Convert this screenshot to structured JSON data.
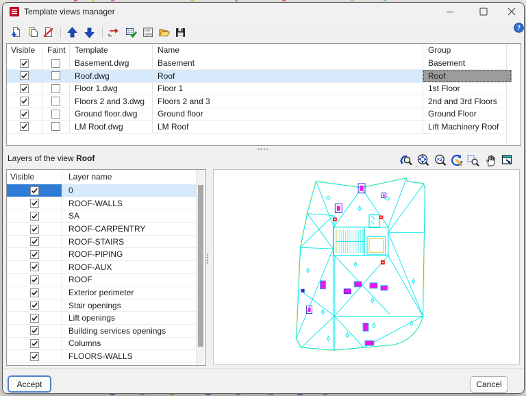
{
  "window": {
    "title": "Template views manager"
  },
  "toolbar": {
    "icons": [
      "new-template",
      "copy-template",
      "delete-template",
      "move-up",
      "move-down",
      "assign-template",
      "update-views",
      "dwg-options",
      "open-file",
      "save-file"
    ]
  },
  "help": {
    "tooltip": "help"
  },
  "templates_table": {
    "headers": {
      "visible": "Visible",
      "faint": "Faint",
      "template": "Template",
      "name": "Name",
      "group": "Group"
    },
    "rows": [
      {
        "visible": true,
        "faint": false,
        "template": "Basement.dwg",
        "name": "Basement",
        "group": "Basement",
        "selected": false
      },
      {
        "visible": true,
        "faint": false,
        "template": "Roof.dwg",
        "name": "Roof",
        "group": "Roof",
        "selected": true
      },
      {
        "visible": true,
        "faint": false,
        "template": "Floor 1.dwg",
        "name": "Floor 1",
        "group": "1st Floor",
        "selected": false
      },
      {
        "visible": true,
        "faint": false,
        "template": "Floors 2 and 3.dwg",
        "name": "Floors 2 and 3",
        "group": "2nd and 3rd Floors",
        "selected": false
      },
      {
        "visible": true,
        "faint": false,
        "template": "Ground floor.dwg",
        "name": "Ground floor",
        "group": "Ground Floor",
        "selected": false
      },
      {
        "visible": true,
        "faint": false,
        "template": "LM Roof.dwg",
        "name": "LM Roof",
        "group": "Lift Machinery Roof",
        "selected": false
      }
    ]
  },
  "layers_panel": {
    "label": "Layers of the view",
    "view_name": "Roof"
  },
  "preview_toolbar": {
    "icons": [
      "zoom-previous",
      "zoom-extents",
      "zoom-scale",
      "regen-view",
      "zoom-window",
      "pan",
      "fit-window"
    ]
  },
  "layers_table": {
    "headers": {
      "visible": "Visible",
      "layer": "Layer name"
    },
    "rows": [
      {
        "visible": true,
        "layer": "0",
        "selected": true
      },
      {
        "visible": true,
        "layer": "ROOF-WALLS",
        "selected": false
      },
      {
        "visible": true,
        "layer": "SA",
        "selected": false
      },
      {
        "visible": true,
        "layer": "ROOF-CARPENTRY",
        "selected": false
      },
      {
        "visible": true,
        "layer": "ROOF-STAIRS",
        "selected": false
      },
      {
        "visible": true,
        "layer": "ROOF-PIPING",
        "selected": false
      },
      {
        "visible": true,
        "layer": "ROOF-AUX",
        "selected": false
      },
      {
        "visible": true,
        "layer": "ROOF",
        "selected": false
      },
      {
        "visible": true,
        "layer": "Exterior perimeter",
        "selected": false
      },
      {
        "visible": true,
        "layer": "Stair openings",
        "selected": false
      },
      {
        "visible": true,
        "layer": "Lift openings",
        "selected": false
      },
      {
        "visible": true,
        "layer": "Building services openings",
        "selected": false
      },
      {
        "visible": true,
        "layer": "Columns",
        "selected": false
      },
      {
        "visible": true,
        "layer": "FLOORS-WALLS",
        "selected": false
      }
    ]
  },
  "footer": {
    "accept": "Accept",
    "cancel": "Cancel"
  },
  "colors": {
    "selection_cell": "#2e7cd6",
    "selection_row": "#d7eafc",
    "selection_gray": "#9c9c9c",
    "drawing_cyan": "#00e6e6",
    "drawing_yellow": "#faf4ae",
    "drawing_magenta": "#e818e8",
    "drawing_red": "#f21818",
    "drawing_blue": "#2a2ae0"
  }
}
